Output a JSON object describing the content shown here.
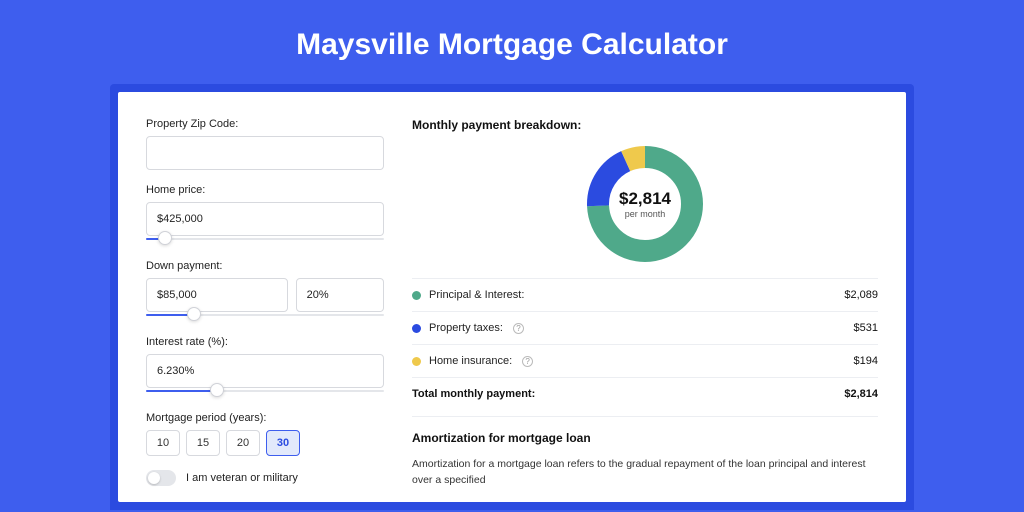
{
  "title": "Maysville Mortgage Calculator",
  "form": {
    "zip": {
      "label": "Property Zip Code:",
      "value": ""
    },
    "price": {
      "label": "Home price:",
      "value": "$425,000",
      "slider_pct": 8
    },
    "down": {
      "label": "Down payment:",
      "amount": "$85,000",
      "pct": "20%",
      "slider_pct": 20
    },
    "rate": {
      "label": "Interest rate (%):",
      "value": "6.230%",
      "slider_pct": 30
    },
    "period": {
      "label": "Mortgage period (years):",
      "options": [
        "10",
        "15",
        "20",
        "30"
      ],
      "selected": "30"
    },
    "veteran": {
      "label": "I am veteran or military",
      "on": false
    }
  },
  "breakdown": {
    "heading": "Monthly payment breakdown:",
    "total_amount": "$2,814",
    "total_sub": "per month",
    "items": [
      {
        "label": "Principal & Interest:",
        "value": "$2,089",
        "color": "#4fa98a",
        "help": false
      },
      {
        "label": "Property taxes:",
        "value": "$531",
        "color": "#2b4be0",
        "help": true
      },
      {
        "label": "Home insurance:",
        "value": "$194",
        "color": "#efc94c",
        "help": true
      }
    ],
    "total_label": "Total monthly payment:",
    "total_value": "$2,814"
  },
  "amort": {
    "heading": "Amortization for mortgage loan",
    "text": "Amortization for a mortgage loan refers to the gradual repayment of the loan principal and interest over a specified"
  },
  "chart_data": {
    "type": "pie",
    "title": "Monthly payment breakdown",
    "series": [
      {
        "name": "Principal & Interest",
        "value": 2089,
        "color": "#4fa98a"
      },
      {
        "name": "Property taxes",
        "value": 531,
        "color": "#2b4be0"
      },
      {
        "name": "Home insurance",
        "value": 194,
        "color": "#efc94c"
      }
    ],
    "total": 2814
  }
}
